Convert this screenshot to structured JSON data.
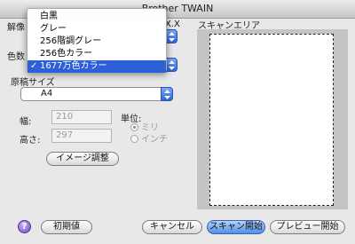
{
  "window": {
    "title": "Brother TWAIN"
  },
  "resolution": {
    "label_partial": "解像",
    "value_partial": "X.X"
  },
  "color_type": {
    "label_partial": "色数",
    "menu_items": [
      "白黒",
      "グレー",
      "256階調グレー",
      "256色カラー",
      "1677万色カラー"
    ],
    "selected_index": 4,
    "check": "✓"
  },
  "document_size": {
    "label": "原稿サイズ",
    "value": "A4"
  },
  "width": {
    "label": "幅:",
    "value": "210"
  },
  "height": {
    "label": "高さ:",
    "value": "297"
  },
  "unit": {
    "label": "単位:",
    "options": [
      "ミリ",
      "インチ"
    ],
    "selected_index": 0
  },
  "buttons": {
    "image_adjust": "イメージ調整",
    "default": "初期値",
    "cancel": "キャンセル",
    "start_scan": "スキャン開始",
    "prescan": "プレビュー開始"
  },
  "scan_area": {
    "label": "スキャンエリア"
  },
  "help": {
    "glyph": "?"
  },
  "colors": {
    "accent": "#2d5fd6",
    "button_blue": "#4f8fe6",
    "scan_bg": "#c4c4c4"
  }
}
